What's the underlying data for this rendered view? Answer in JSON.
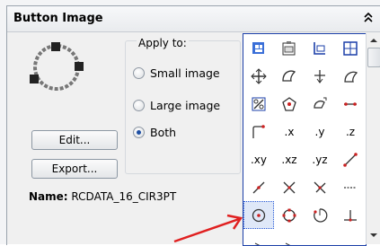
{
  "panel": {
    "title": "Button Image"
  },
  "apply_to": {
    "label": "Apply to:",
    "options": [
      "Small image",
      "Large image",
      "Both"
    ],
    "selected": "Both"
  },
  "buttons": {
    "edit": "Edit...",
    "export": "Export..."
  },
  "name": {
    "label": "Name:",
    "value": "RCDATA_16_CIR3PT"
  },
  "icon_grid": {
    "text_cells": [
      ".x",
      ".y",
      ".z",
      ".xy",
      ".xz",
      ".yz"
    ],
    "selected_icon": "circle-3pt-icon"
  },
  "colors": {
    "grid_border": "#1b3fa8",
    "annotation_arrow": "#e02020"
  }
}
